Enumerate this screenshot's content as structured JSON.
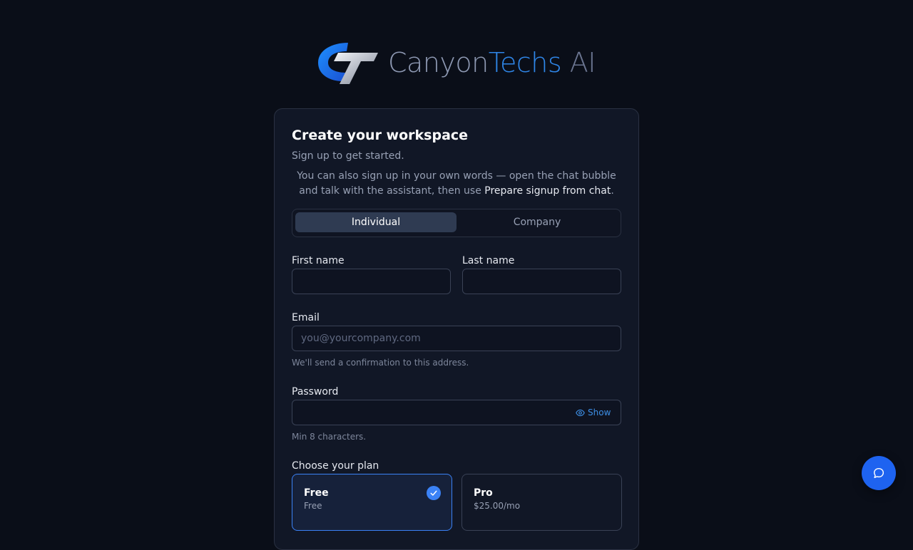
{
  "brand": {
    "part1": "Canyon",
    "part2": "Techs",
    "part3": " AI",
    "colors": {
      "part1": "#8e99b3",
      "part2": "#2f86e8",
      "part3": "#6b7591"
    }
  },
  "card": {
    "title": "Create your workspace",
    "subtitle": "Sign up to get started.",
    "hint_prefix": "You can also sign up in your own words — open the chat bubble and talk with the assistant, then use ",
    "hint_strong": "Prepare signup from chat",
    "hint_suffix": "."
  },
  "account_type": {
    "options": [
      "Individual",
      "Company"
    ],
    "selected": "Individual"
  },
  "form": {
    "first_name": {
      "label": "First name",
      "value": "",
      "placeholder": ""
    },
    "last_name": {
      "label": "Last name",
      "value": "",
      "placeholder": ""
    },
    "email": {
      "label": "Email",
      "value": "",
      "placeholder": "you@yourcompany.com",
      "help": "We'll send a confirmation to this address."
    },
    "password": {
      "label": "Password",
      "value": "",
      "placeholder": "",
      "help": "Min 8 characters.",
      "show_label": "Show"
    }
  },
  "plans": {
    "label": "Choose your plan",
    "items": [
      {
        "name": "Free",
        "price": "Free",
        "selected": true
      },
      {
        "name": "Pro",
        "price": "$25.00/mo",
        "selected": false
      }
    ]
  },
  "icons": {
    "logo": "canyontechs-logo-icon",
    "eye": "eye-icon",
    "check": "check-icon",
    "chat": "chat-bubble-icon"
  },
  "accent": "#3b82f6"
}
